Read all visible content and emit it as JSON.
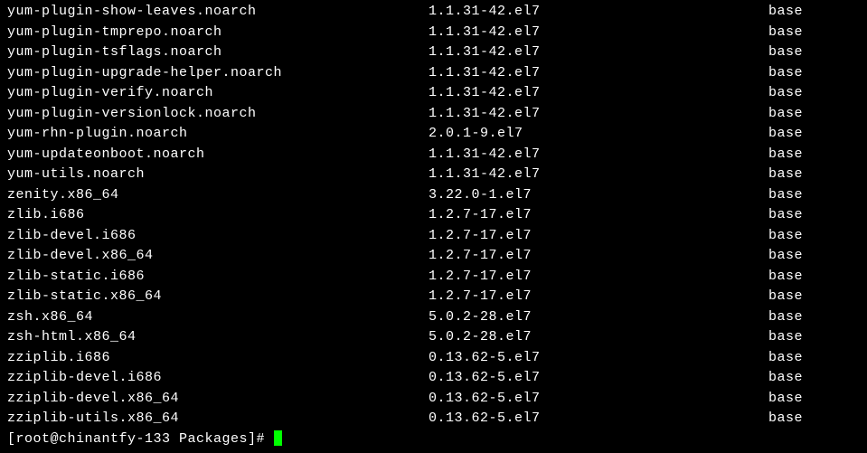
{
  "packages": [
    {
      "name": "yum-plugin-show-leaves.noarch",
      "version": "1.1.31-42.el7",
      "repo": "base"
    },
    {
      "name": "yum-plugin-tmprepo.noarch",
      "version": "1.1.31-42.el7",
      "repo": "base"
    },
    {
      "name": "yum-plugin-tsflags.noarch",
      "version": "1.1.31-42.el7",
      "repo": "base"
    },
    {
      "name": "yum-plugin-upgrade-helper.noarch",
      "version": "1.1.31-42.el7",
      "repo": "base"
    },
    {
      "name": "yum-plugin-verify.noarch",
      "version": "1.1.31-42.el7",
      "repo": "base"
    },
    {
      "name": "yum-plugin-versionlock.noarch",
      "version": "1.1.31-42.el7",
      "repo": "base"
    },
    {
      "name": "yum-rhn-plugin.noarch",
      "version": "2.0.1-9.el7",
      "repo": "base"
    },
    {
      "name": "yum-updateonboot.noarch",
      "version": "1.1.31-42.el7",
      "repo": "base"
    },
    {
      "name": "yum-utils.noarch",
      "version": "1.1.31-42.el7",
      "repo": "base"
    },
    {
      "name": "zenity.x86_64",
      "version": "3.22.0-1.el7",
      "repo": "base"
    },
    {
      "name": "zlib.i686",
      "version": "1.2.7-17.el7",
      "repo": "base"
    },
    {
      "name": "zlib-devel.i686",
      "version": "1.2.7-17.el7",
      "repo": "base"
    },
    {
      "name": "zlib-devel.x86_64",
      "version": "1.2.7-17.el7",
      "repo": "base"
    },
    {
      "name": "zlib-static.i686",
      "version": "1.2.7-17.el7",
      "repo": "base"
    },
    {
      "name": "zlib-static.x86_64",
      "version": "1.2.7-17.el7",
      "repo": "base"
    },
    {
      "name": "zsh.x86_64",
      "version": "5.0.2-28.el7",
      "repo": "base"
    },
    {
      "name": "zsh-html.x86_64",
      "version": "5.0.2-28.el7",
      "repo": "base"
    },
    {
      "name": "zziplib.i686",
      "version": "0.13.62-5.el7",
      "repo": "base"
    },
    {
      "name": "zziplib-devel.i686",
      "version": "0.13.62-5.el7",
      "repo": "base"
    },
    {
      "name": "zziplib-devel.x86_64",
      "version": "0.13.62-5.el7",
      "repo": "base"
    },
    {
      "name": "zziplib-utils.x86_64",
      "version": "0.13.62-5.el7",
      "repo": "base"
    }
  ],
  "prompt": "[root@chinantfy-133 Packages]# "
}
